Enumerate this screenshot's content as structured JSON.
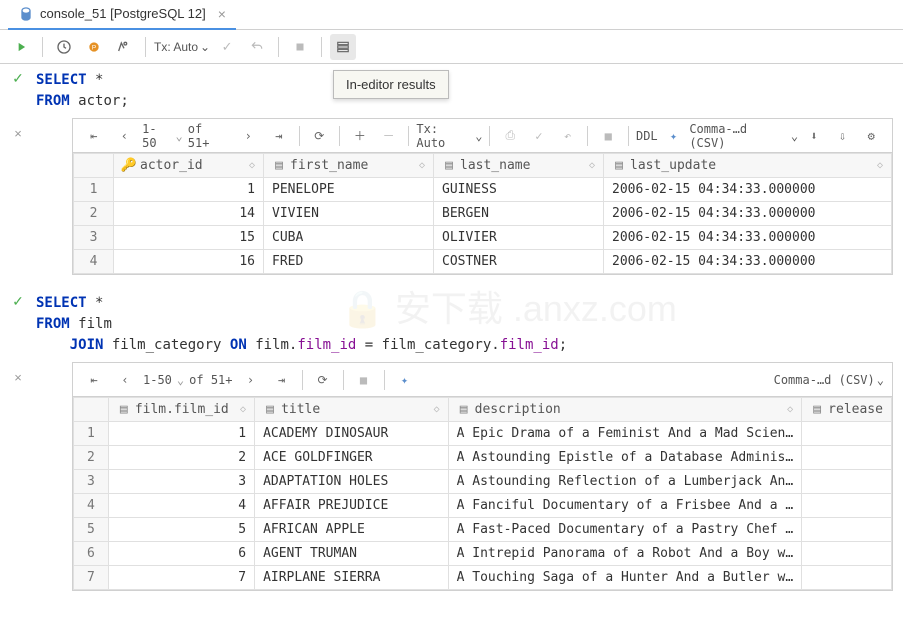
{
  "tab": {
    "title": "console_51 [PostgreSQL 12]"
  },
  "toolbar": {
    "tx_label": "Tx: Auto"
  },
  "tooltip": "In-editor results",
  "query1": {
    "sql_kw1": "SELECT",
    "sql_star": "*",
    "sql_kw2": "FROM",
    "sql_tbl": "actor",
    "sql_end": ";",
    "pager": {
      "range": "1-50",
      "of": "of 51+"
    },
    "tx": "Tx: Auto",
    "ddl": "DDL",
    "export_fmt": "Comma-…d (CSV)",
    "columns": [
      "actor_id",
      "first_name",
      "last_name",
      "last_update"
    ],
    "rows": [
      {
        "n": "1",
        "actor_id": "1",
        "first_name": "PENELOPE",
        "last_name": "GUINESS",
        "last_update": "2006-02-15 04:34:33.000000"
      },
      {
        "n": "2",
        "actor_id": "14",
        "first_name": "VIVIEN",
        "last_name": "BERGEN",
        "last_update": "2006-02-15 04:34:33.000000"
      },
      {
        "n": "3",
        "actor_id": "15",
        "first_name": "CUBA",
        "last_name": "OLIVIER",
        "last_update": "2006-02-15 04:34:33.000000"
      },
      {
        "n": "4",
        "actor_id": "16",
        "first_name": "FRED",
        "last_name": "COSTNER",
        "last_update": "2006-02-15 04:34:33.000000"
      }
    ]
  },
  "query2": {
    "sql_kw1": "SELECT",
    "sql_star": "*",
    "sql_kw2": "FROM",
    "sql_tbl": "film",
    "sql_kw3": "JOIN",
    "sql_tbl2": "film_category",
    "sql_kw4": "ON",
    "sql_f1": "film",
    "sql_f1c": "film_id",
    "sql_eq": "=",
    "sql_f2": "film_category",
    "sql_f2c": "film_id",
    "sql_end": ";",
    "pager": {
      "range": "1-50",
      "of": "of 51+"
    },
    "export_fmt": "Comma-…d (CSV)",
    "columns": [
      "film.film_id",
      "title",
      "description",
      "release"
    ],
    "rows": [
      {
        "n": "1",
        "id": "1",
        "title": "ACADEMY DINOSAUR",
        "desc": "A Epic Drama of a Feminist And a Mad Scien…"
      },
      {
        "n": "2",
        "id": "2",
        "title": "ACE GOLDFINGER",
        "desc": "A Astounding Epistle of a Database Adminis…"
      },
      {
        "n": "3",
        "id": "3",
        "title": "ADAPTATION HOLES",
        "desc": "A Astounding Reflection of a Lumberjack An…"
      },
      {
        "n": "4",
        "id": "4",
        "title": "AFFAIR PREJUDICE",
        "desc": "A Fanciful Documentary of a Frisbee And a …"
      },
      {
        "n": "5",
        "id": "5",
        "title": "AFRICAN APPLE",
        "desc": "A Fast-Paced Documentary of a Pastry Chef …"
      },
      {
        "n": "6",
        "id": "6",
        "title": "AGENT TRUMAN",
        "desc": "A Intrepid Panorama of a Robot And a Boy w…"
      },
      {
        "n": "7",
        "id": "7",
        "title": "AIRPLANE SIERRA",
        "desc": "A Touching Saga of a Hunter And a Butler w…"
      }
    ]
  }
}
